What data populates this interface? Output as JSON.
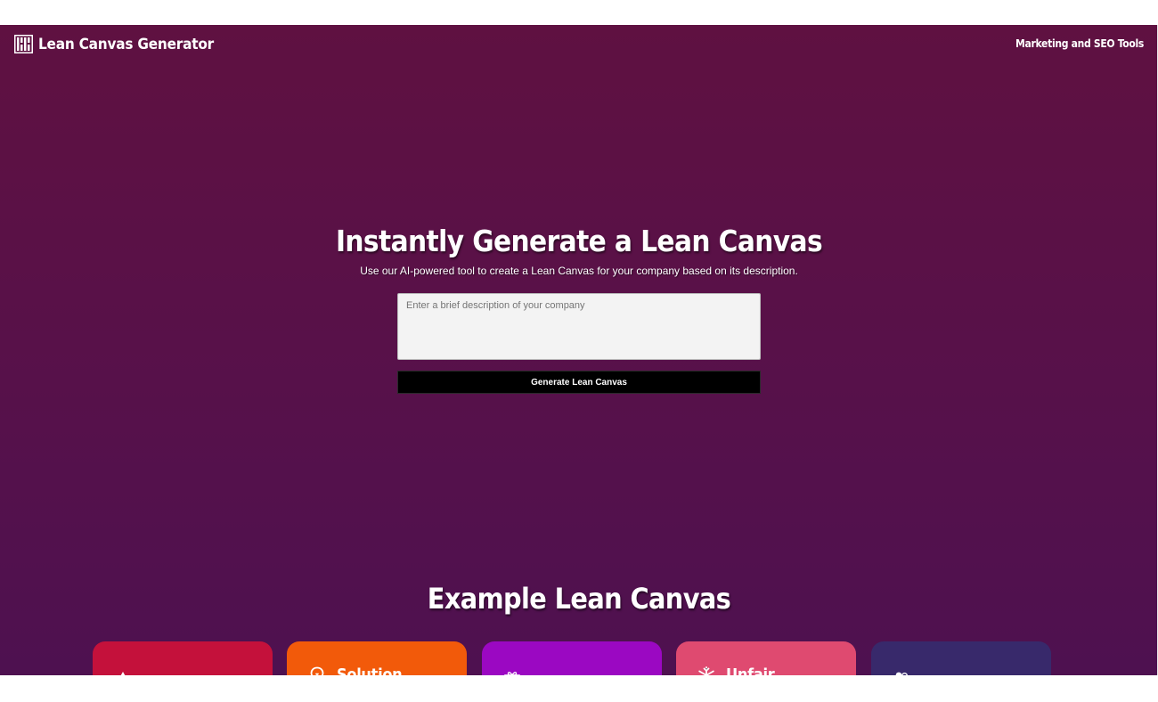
{
  "header": {
    "brand_title": "Lean Canvas Generator",
    "brand_icon": "canvas-grid-icon",
    "nav_link": "Marketing and SEO Tools"
  },
  "hero": {
    "title": "Instantly Generate a Lean Canvas",
    "subtitle": "Use our AI-powered tool to create a Lean Canvas for your company based on its description.",
    "input_placeholder": "Enter a brief description of your company",
    "input_value": "",
    "button_label": "Generate Lean Canvas"
  },
  "examples": {
    "title": "Example Lean Canvas",
    "cards": [
      {
        "title": "",
        "icon": "warning-icon",
        "color": "#c4113b"
      },
      {
        "title": "Solution",
        "icon": "lightbulb-icon",
        "color": "#f25a0a"
      },
      {
        "title": "",
        "icon": "gift-icon",
        "color": "#9b08c2"
      },
      {
        "title": "Unfair Advantage",
        "icon": "snowflake-icon",
        "color": "#df4a70"
      },
      {
        "title": "",
        "icon": "users-icon",
        "color": "#38296b"
      }
    ]
  },
  "colors": {
    "background_top": "#5f1141",
    "background_bottom": "#4e1150",
    "button": "#000000",
    "input_background": "#f3f3f3"
  }
}
